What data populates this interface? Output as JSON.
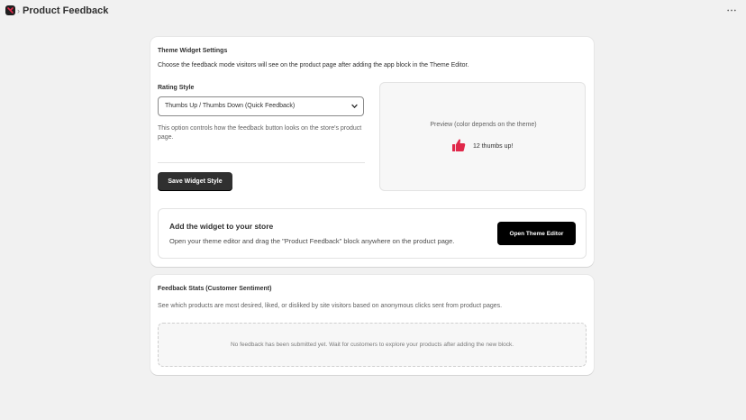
{
  "header": {
    "title": "Product Feedback",
    "separator": "›",
    "more_label": "···"
  },
  "settings": {
    "title": "Theme Widget Settings",
    "description": "Choose the feedback mode visitors will see on the product page after adding the app block in the Theme Editor.",
    "rating_label": "Rating Style",
    "rating_value": "Thumbs Up / Thumbs Down (Quick Feedback)",
    "help_text": "This option controls how the feedback button looks on the store's product page.",
    "save_label": "Save Widget Style",
    "preview_label": "Preview (color depends on the theme)",
    "thumb_count": "12 thumbs up!",
    "thumb_color": "#e0284a"
  },
  "widget": {
    "title": "Add the widget to your store",
    "description": "Open your theme editor and drag the \"Product Feedback\" block anywhere on the product page.",
    "button_label": "Open Theme Editor"
  },
  "stats": {
    "title": "Feedback Stats (Customer Sentiment)",
    "description": "See which products are most desired, liked, or disliked by site visitors based on anonymous clicks sent from product pages.",
    "empty_text": "No feedback has been submitted yet. Wait for customers to explore your products after adding the new block."
  }
}
